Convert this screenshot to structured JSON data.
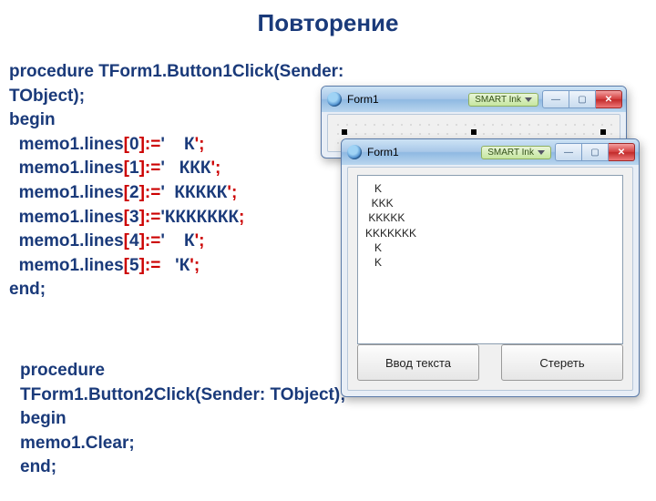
{
  "title": "Повторение",
  "code1": {
    "l0a": "procedure TForm1.Button1Click(Sender:",
    "l0b": "TObject);",
    "l1": "begin",
    "m": "memo1.lines",
    "br_o": "[",
    "br_c": "]:=",
    "idx": [
      "0",
      "1",
      "2",
      "3",
      "4",
      "5"
    ],
    "q": "'",
    "seg": [
      {
        "pad": "    ",
        "val": "К"
      },
      {
        "pad": "   ",
        "val": "ККК"
      },
      {
        "pad": "  ",
        "val": "ККККК"
      },
      {
        "pad": "",
        "val": "ККККККК"
      },
      {
        "pad": "    ",
        "val": "К"
      },
      {
        "pad": "   ",
        "val": "'К"
      }
    ],
    "semi": ";",
    "end": "end;"
  },
  "code2": {
    "l0": "procedure",
    "l1": "TForm1.Button2Click(Sender: TObject);",
    "l2": "begin",
    "l3": "  memo1.Clear;",
    "l4": "end;"
  },
  "win_back": {
    "title": "Form1",
    "smart": "SMART Ink"
  },
  "win_front": {
    "title": "Form1",
    "smart": "SMART Ink",
    "memo_text": "   K\n  KKK\n KKKKK\nKKKKKKK\n   K\n   K",
    "btn1": "Ввод текста",
    "btn2": "Стереть"
  },
  "icons": {
    "min": "—",
    "max": "▢",
    "close": "✕"
  }
}
